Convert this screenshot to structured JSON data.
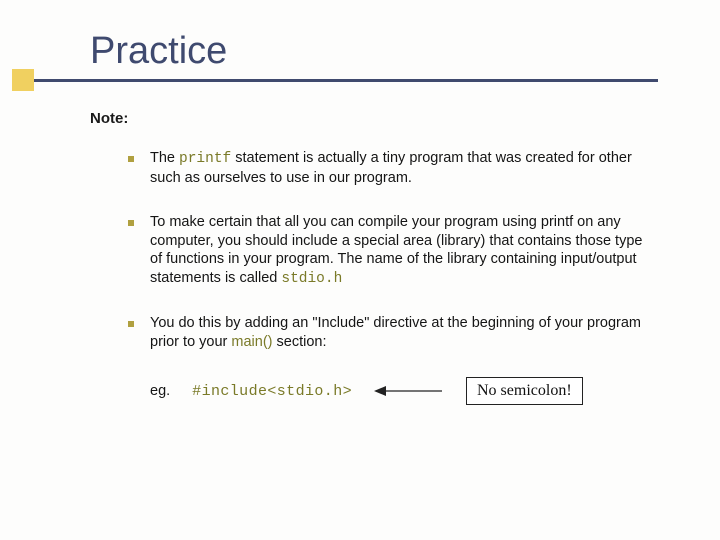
{
  "title": "Practice",
  "note_label": "Note:",
  "bullets": [
    {
      "pre": "The ",
      "code": "printf",
      "post": " statement is actually a tiny program that was created for other such as ourselves to use in our program."
    },
    {
      "pre": "To make certain that all you can compile your program using printf on any computer, you should include a special area (library) that contains those type of functions in your program. The name of the library containing input/output statements is called ",
      "code": "stdio.h",
      "post": ""
    },
    {
      "pre": "You do this by adding an \"Include\" directive at the beginning of your program prior to your ",
      "code": "main()",
      "post": " section:"
    }
  ],
  "example": {
    "label": "eg.",
    "code": "#include<stdio.h>",
    "callout": "No semicolon!"
  }
}
